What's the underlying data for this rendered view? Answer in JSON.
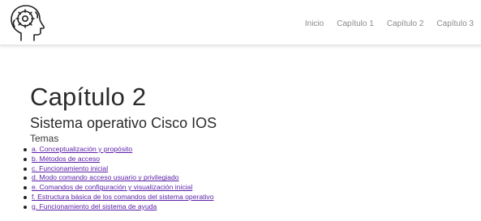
{
  "header": {
    "logo_icon": "brain-gear-head-icon",
    "nav": [
      {
        "label": "Inicio"
      },
      {
        "label": "Capítulo 1"
      },
      {
        "label": "Capítulo 2"
      },
      {
        "label": "Capítulo 3"
      }
    ]
  },
  "main": {
    "title": "Capítulo 2",
    "subtitle": "Sistema operativo Cisco IOS",
    "topics_label": "Temas",
    "topics": [
      {
        "label": "a. Conceptualización y propósito"
      },
      {
        "label": "b. Métodos de acceso"
      },
      {
        "label": "c. Funcionamiento inicial"
      },
      {
        "label": "d. Modo comando acceso usuario y privilegiado"
      },
      {
        "label": "e. Comandos de configuración y visualización inicial"
      },
      {
        "label": "f. Estructura básica de los comandos del sistema operativo"
      },
      {
        "label": "g. Funcionamiento del sistema de ayuda"
      }
    ]
  },
  "colors": {
    "link": "#5a1ea8",
    "nav_text": "#8a8a8a",
    "heading": "#2b2b2b",
    "background": "#ffffff"
  }
}
